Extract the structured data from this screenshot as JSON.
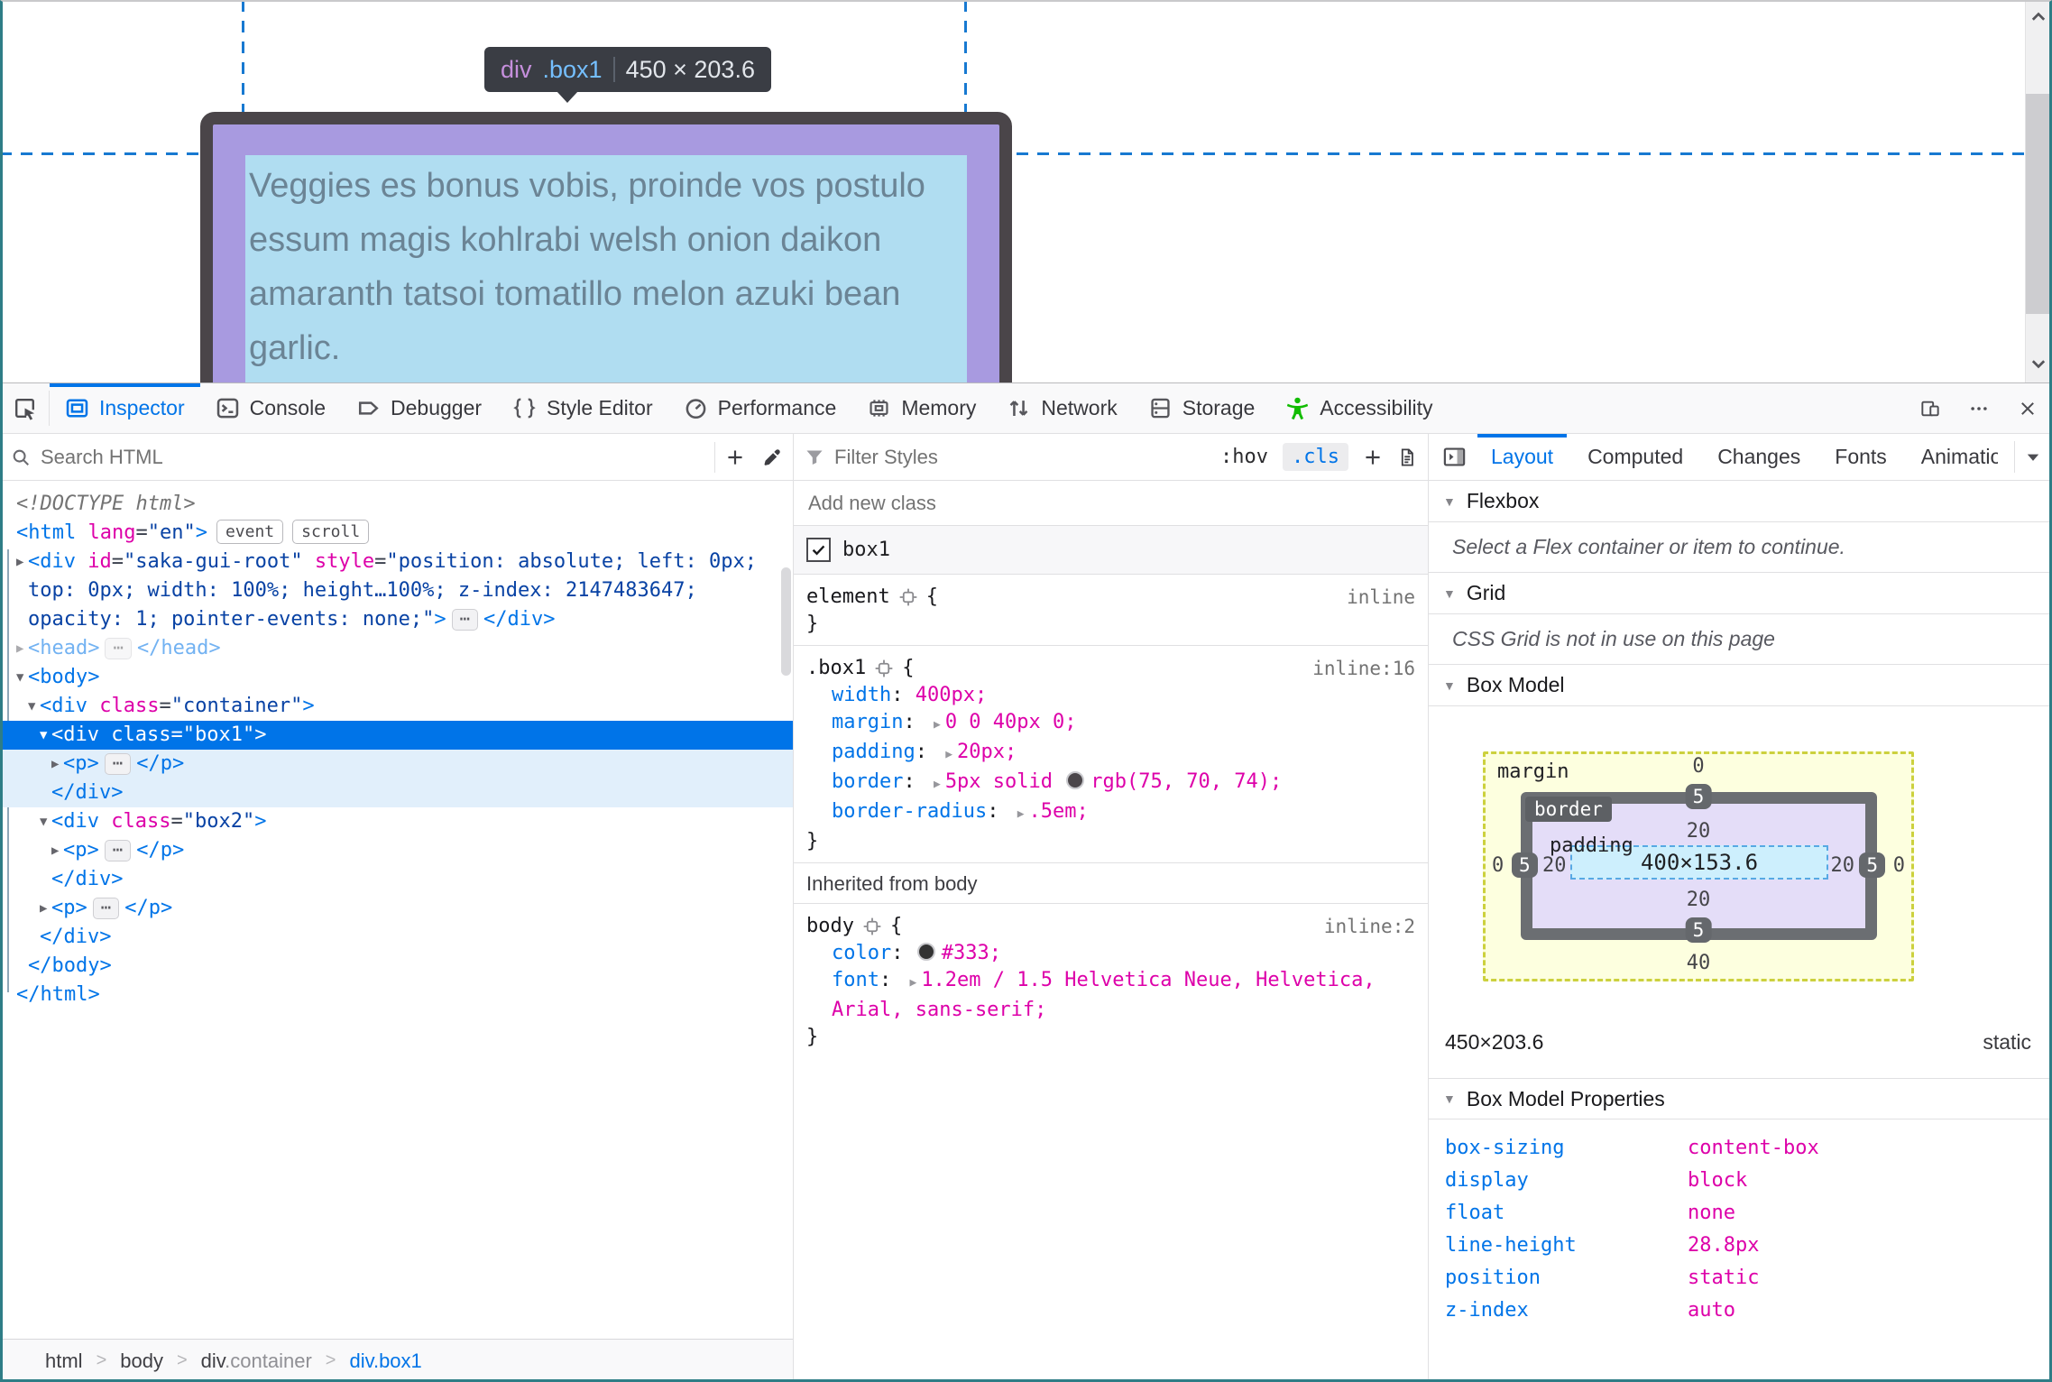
{
  "colors": {
    "accent_blue": "#0074e8",
    "property_magenta": "#dd00a9",
    "attr_value_navy": "#0842a4",
    "selection_blue": "#0074e8",
    "a11y_green": "#12bc00",
    "guide_blue": "#1779d1",
    "highlight_border": "#4a4549",
    "highlight_padding": "#a89ae0",
    "highlight_content": "#b0ddf1",
    "bm_margin_bg": "#fdffdf",
    "bm_padding_bg": "#e4ddf8",
    "bm_content_bg": "#cdeffd",
    "tooltip_bg": "#3a3d44",
    "window_frame": "#2e7d86"
  },
  "syntax": {
    "open": "{",
    "close": "}",
    "colon": ": ",
    "ellipsis": "⋯",
    "twisty_open": "▼",
    "twisty_closed": "▶"
  },
  "viewport": {
    "tooltip": {
      "tag": "div",
      "selector": ".box1",
      "dims": "450 × 203.6"
    },
    "content_lines": [
      "Veggies es bonus vobis, proinde vos postulo",
      "essum magis kohlrabi welsh onion daikon",
      "amaranth tatsoi tomatillo melon azuki bean",
      "garlic."
    ]
  },
  "toolbar": {
    "tabs": [
      {
        "label": "Inspector",
        "icon": "inspector-icon",
        "active": true
      },
      {
        "label": "Console",
        "icon": "console-icon"
      },
      {
        "label": "Debugger",
        "icon": "debugger-icon"
      },
      {
        "label": "Style Editor",
        "icon": "style-editor-icon"
      },
      {
        "label": "Performance",
        "icon": "performance-icon"
      },
      {
        "label": "Memory",
        "icon": "memory-icon"
      },
      {
        "label": "Network",
        "icon": "network-icon"
      },
      {
        "label": "Storage",
        "icon": "storage-icon"
      },
      {
        "label": "Accessibility",
        "icon": "accessibility-icon",
        "green": true
      }
    ],
    "right_icons": [
      "responsive-mode-icon",
      "menu-dots-icon",
      "close-icon"
    ]
  },
  "markup_panel": {
    "search_placeholder": "Search HTML",
    "tree": [
      {
        "level": 0,
        "tokens": [
          {
            "t": "<!DOCTYPE html>",
            "c": "doctype"
          }
        ]
      },
      {
        "level": 0,
        "tokens": [
          {
            "t": "<html ",
            "c": "tag"
          },
          {
            "t": "lang",
            "c": "attr"
          },
          {
            "t": "=",
            "c": "plain"
          },
          {
            "t": "\"en\"",
            "c": "val"
          },
          {
            "t": ">",
            "c": "tag"
          },
          {
            "badge": "event"
          },
          {
            "badge": "scroll"
          }
        ]
      },
      {
        "level": 1,
        "twisty": "closed",
        "tokens": [
          {
            "t": "<div ",
            "c": "tag"
          },
          {
            "t": "id",
            "c": "attr"
          },
          {
            "t": "=",
            "c": "plain"
          },
          {
            "t": "\"saka-gui-root\"",
            "c": "val"
          },
          {
            "t": " ",
            "c": "plain"
          },
          {
            "t": "style",
            "c": "attr"
          },
          {
            "t": "=",
            "c": "plain"
          },
          {
            "t": "\"position: absolute; left: 0px; top: 0px; width: 100%; height…100%; z-index: 2147483647; opacity: 1; pointer-events: none;\"",
            "c": "val"
          },
          {
            "t": ">",
            "c": "tag"
          },
          {
            "chip": true
          },
          {
            "t": "</div>",
            "c": "tag"
          }
        ]
      },
      {
        "level": 1,
        "twisty": "closed",
        "dim": true,
        "tokens": [
          {
            "t": "<head>",
            "c": "tag"
          },
          {
            "chip": true
          },
          {
            "t": "</head>",
            "c": "tag"
          }
        ]
      },
      {
        "level": 1,
        "twisty": "open",
        "tokens": [
          {
            "t": "<body>",
            "c": "tag"
          }
        ]
      },
      {
        "level": 2,
        "twisty": "open",
        "tokens": [
          {
            "t": "<div ",
            "c": "tag"
          },
          {
            "t": "class",
            "c": "attr"
          },
          {
            "t": "=",
            "c": "plain"
          },
          {
            "t": "\"container\"",
            "c": "val"
          },
          {
            "t": ">",
            "c": "tag"
          }
        ]
      },
      {
        "level": 3,
        "twisty": "open",
        "selected": true,
        "tokens": [
          {
            "t": "<div ",
            "c": "tag"
          },
          {
            "t": "class",
            "c": "attr"
          },
          {
            "t": "=",
            "c": "plain"
          },
          {
            "t": "\"box1\"",
            "c": "val"
          },
          {
            "t": ">",
            "c": "tag"
          }
        ]
      },
      {
        "level": 4,
        "twisty": "closed",
        "shade": true,
        "tokens": [
          {
            "t": "<p>",
            "c": "tag"
          },
          {
            "chip": true
          },
          {
            "t": "</p>",
            "c": "tag"
          }
        ]
      },
      {
        "level": 3,
        "shade": true,
        "tokens": [
          {
            "t": "</div>",
            "c": "tag"
          }
        ]
      },
      {
        "level": 3,
        "twisty": "open",
        "tokens": [
          {
            "t": "<div ",
            "c": "tag"
          },
          {
            "t": "class",
            "c": "attr"
          },
          {
            "t": "=",
            "c": "plain"
          },
          {
            "t": "\"box2\"",
            "c": "val"
          },
          {
            "t": ">",
            "c": "tag"
          }
        ]
      },
      {
        "level": 4,
        "twisty": "closed",
        "tokens": [
          {
            "t": "<p>",
            "c": "tag"
          },
          {
            "chip": true
          },
          {
            "t": "</p>",
            "c": "tag"
          }
        ]
      },
      {
        "level": 3,
        "tokens": [
          {
            "t": "</div>",
            "c": "tag"
          }
        ]
      },
      {
        "level": 3,
        "twisty": "closed",
        "tokens": [
          {
            "t": "<p>",
            "c": "tag"
          },
          {
            "chip": true
          },
          {
            "t": "</p>",
            "c": "tag"
          }
        ]
      },
      {
        "level": 2,
        "tokens": [
          {
            "t": "</div>",
            "c": "tag"
          }
        ]
      },
      {
        "level": 1,
        "tokens": [
          {
            "t": "</body>",
            "c": "tag"
          }
        ]
      },
      {
        "level": 0,
        "tokens": [
          {
            "t": "</html>",
            "c": "tag"
          }
        ]
      }
    ],
    "breadcrumb_separator": ">",
    "breadcrumbs": [
      {
        "segs": [
          {
            "t": "html",
            "c": "el"
          }
        ]
      },
      {
        "segs": [
          {
            "t": "body",
            "c": "el"
          }
        ]
      },
      {
        "segs": [
          {
            "t": "div",
            "c": "el"
          },
          {
            "t": ".container",
            "c": "cls"
          }
        ]
      },
      {
        "segs": [
          {
            "t": "div.box1",
            "c": "sel"
          }
        ]
      }
    ]
  },
  "rules_panel": {
    "filter_placeholder": "Filter Styles",
    "toggles": {
      "hov": ":hov",
      "cls": ".cls"
    },
    "add_class_placeholder": "Add new class",
    "class_toggle": {
      "label": "box1",
      "checked": true
    },
    "rules": [
      {
        "selector": "element",
        "location": "inline",
        "props": []
      },
      {
        "selector": ".box1",
        "location": "inline:16",
        "props": [
          {
            "name": "width",
            "value": "400px;"
          },
          {
            "name": "margin",
            "expand": true,
            "value": "0 0 40px 0;"
          },
          {
            "name": "padding",
            "expand": true,
            "value": "20px;"
          },
          {
            "name": "border",
            "expand": true,
            "pre": "5px solid ",
            "swatch": "#4b464a",
            "value": "rgb(75, 70, 74);"
          },
          {
            "name": "border-radius",
            "expand": true,
            "value": ".5em;"
          }
        ]
      }
    ],
    "inherited_header": "Inherited from body",
    "body_rule": {
      "selector": "body",
      "location": "inline:2",
      "props": [
        {
          "name": "color",
          "swatch": "#333333",
          "value": "#333;"
        },
        {
          "name": "font",
          "expand": true,
          "value": "1.2em / 1.5 Helvetica Neue, Helvetica, Arial, sans-serif;"
        }
      ]
    }
  },
  "layout_panel": {
    "tabs": [
      {
        "label": "Layout",
        "active": true
      },
      {
        "label": "Computed"
      },
      {
        "label": "Changes"
      },
      {
        "label": "Fonts"
      },
      {
        "label": "Animations",
        "truncated": true
      }
    ],
    "sections": {
      "flexbox": {
        "title": "Flexbox",
        "message": "Select a Flex container or item to continue."
      },
      "grid": {
        "title": "Grid",
        "message": "CSS Grid is not in use on this page"
      },
      "box_model": {
        "title": "Box Model",
        "margin": {
          "label": "margin",
          "top": "0",
          "right": "0",
          "bottom": "40",
          "left": "0"
        },
        "border": {
          "label": "border",
          "top": "5",
          "right": "5",
          "bottom": "5",
          "left": "5"
        },
        "padding": {
          "label": "padding",
          "top": "20",
          "right": "20",
          "bottom": "20",
          "left": "20"
        },
        "content": "400×153.6",
        "dims": "450×203.6",
        "position": "static"
      },
      "properties": {
        "title": "Box Model Properties",
        "items": [
          {
            "name": "box-sizing",
            "value": "content-box"
          },
          {
            "name": "display",
            "value": "block"
          },
          {
            "name": "float",
            "value": "none"
          },
          {
            "name": "line-height",
            "value": "28.8px"
          },
          {
            "name": "position",
            "value": "static"
          },
          {
            "name": "z-index",
            "value": "auto"
          }
        ]
      }
    }
  }
}
